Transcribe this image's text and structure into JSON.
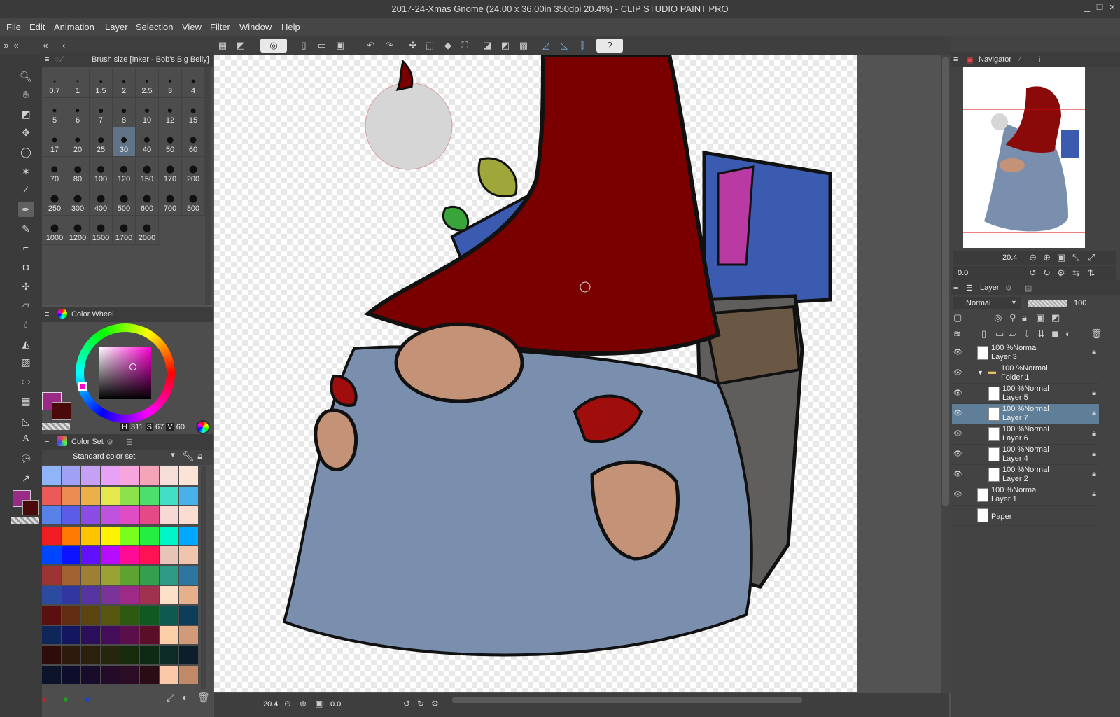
{
  "app": {
    "title": "2017-24-Xmas Gnome (24.00 x 36.00in 350dpi 20.4%) - CLIP STUDIO PAINT PRO",
    "window_buttons": [
      "minimize-icon",
      "maximize-icon",
      "close-icon"
    ]
  },
  "menu": [
    "File",
    "Edit",
    "Animation",
    "Layer",
    "Selection",
    "View",
    "Filter",
    "Window",
    "Help"
  ],
  "brush_size": {
    "title": "Brush size [Inker - Bob's Big Belly]",
    "sizes": [
      "0.7",
      "1",
      "1.5",
      "2",
      "2.5",
      "3",
      "4",
      "5",
      "6",
      "7",
      "8",
      "10",
      "12",
      "15",
      "17",
      "20",
      "25",
      "30",
      "40",
      "50",
      "60",
      "70",
      "80",
      "100",
      "120",
      "150",
      "170",
      "200",
      "250",
      "300",
      "400",
      "500",
      "600",
      "700",
      "800",
      "1000",
      "1200",
      "1500",
      "1700",
      "2000"
    ],
    "selected": "30"
  },
  "color_wheel": {
    "title": "Color Wheel",
    "h_label": "H",
    "h": "311",
    "s_label": "S",
    "s": "67",
    "v_label": "V",
    "v": "60",
    "main_color": "#9b2a86",
    "sub_color": "#4a0a0a"
  },
  "color_set": {
    "title": "Color Set",
    "set_name": "Standard color set",
    "rows": [
      [
        "#8fb4f8",
        "#a0a0f5",
        "#c5a0f5",
        "#e8a2f5",
        "#f7a5dd",
        "#f5a3b6",
        "#f6dfd8",
        "#fbe4d6"
      ],
      [
        "#ea5a58",
        "#ec8c52",
        "#ebb048",
        "#e5e84d",
        "#8be24b",
        "#4ddf6c",
        "#43dec6",
        "#49b0ea"
      ],
      [
        "#5882ea",
        "#5b5ce8",
        "#8a4ce3",
        "#c052e0",
        "#e04cc4",
        "#e34a86",
        "#f6d8d4",
        "#fbdcd0"
      ],
      [
        "#f01e23",
        "#ff7a00",
        "#ffc400",
        "#fff200",
        "#78ff1c",
        "#22ef40",
        "#00f5c8",
        "#00a8ff"
      ],
      [
        "#0045ff",
        "#0c14ff",
        "#6210ff",
        "#b70cff",
        "#ff0c96",
        "#ff1254",
        "#e8c4b8",
        "#efc5ae"
      ],
      [
        "#9c3434",
        "#a36231",
        "#9d8034",
        "#9aa234",
        "#5ea231",
        "#32a04f",
        "#2f9b87",
        "#2d76a0"
      ],
      [
        "#2c4ba0",
        "#3236a1",
        "#5735a0",
        "#7a3399",
        "#9c2a86",
        "#a0324f",
        "#fde0c8",
        "#e6b08c"
      ],
      [
        "#5a1010",
        "#602e10",
        "#5c4410",
        "#56560e",
        "#2d5a10",
        "#0e5a22",
        "#0e5a50",
        "#0e3d5a"
      ],
      [
        "#0f2658",
        "#151660",
        "#2c0e5a",
        "#450e5a",
        "#5a0e4a",
        "#5a0e28",
        "#fbcfa8",
        "#d19a78"
      ],
      [
        "#2e0c0c",
        "#2c1a0c",
        "#2a200c",
        "#26260c",
        "#162a0c",
        "#0c2a14",
        "#0c2a26",
        "#0c1e2a"
      ],
      [
        "#0c142a",
        "#0e0e2c",
        "#180c2a",
        "#220c2a",
        "#2a0c24",
        "#2a0c14",
        "#fbc9a8",
        "#c08a68"
      ]
    ]
  },
  "navigator": {
    "title": "Navigator",
    "zoom": "20.4",
    "rotation": "0.0"
  },
  "layers": {
    "title": "Layer",
    "blend_mode": "Normal",
    "opacity": "100",
    "items": [
      {
        "mode": "100 %Normal",
        "name": "Layer 3",
        "type": "raster",
        "indent": 0
      },
      {
        "mode": "100 %Normal",
        "name": "Folder 1",
        "type": "folder",
        "indent": 0
      },
      {
        "mode": "100 %Normal",
        "name": "Layer 5",
        "type": "raster",
        "indent": 1
      },
      {
        "mode": "100 %Normal",
        "name": "Layer 7",
        "type": "raster",
        "indent": 1,
        "selected": true
      },
      {
        "mode": "100 %Normal",
        "name": "Layer 6",
        "type": "raster",
        "indent": 1
      },
      {
        "mode": "100 %Normal",
        "name": "Layer 4",
        "type": "raster",
        "indent": 1
      },
      {
        "mode": "100 %Normal",
        "name": "Layer 2",
        "type": "raster",
        "indent": 1
      },
      {
        "mode": "100 %Normal",
        "name": "Layer 1",
        "type": "raster",
        "indent": 0
      },
      {
        "mode": "",
        "name": "Paper",
        "type": "paper",
        "indent": 0
      }
    ]
  },
  "status": {
    "zoom": "20.4",
    "angle": "0.0"
  }
}
